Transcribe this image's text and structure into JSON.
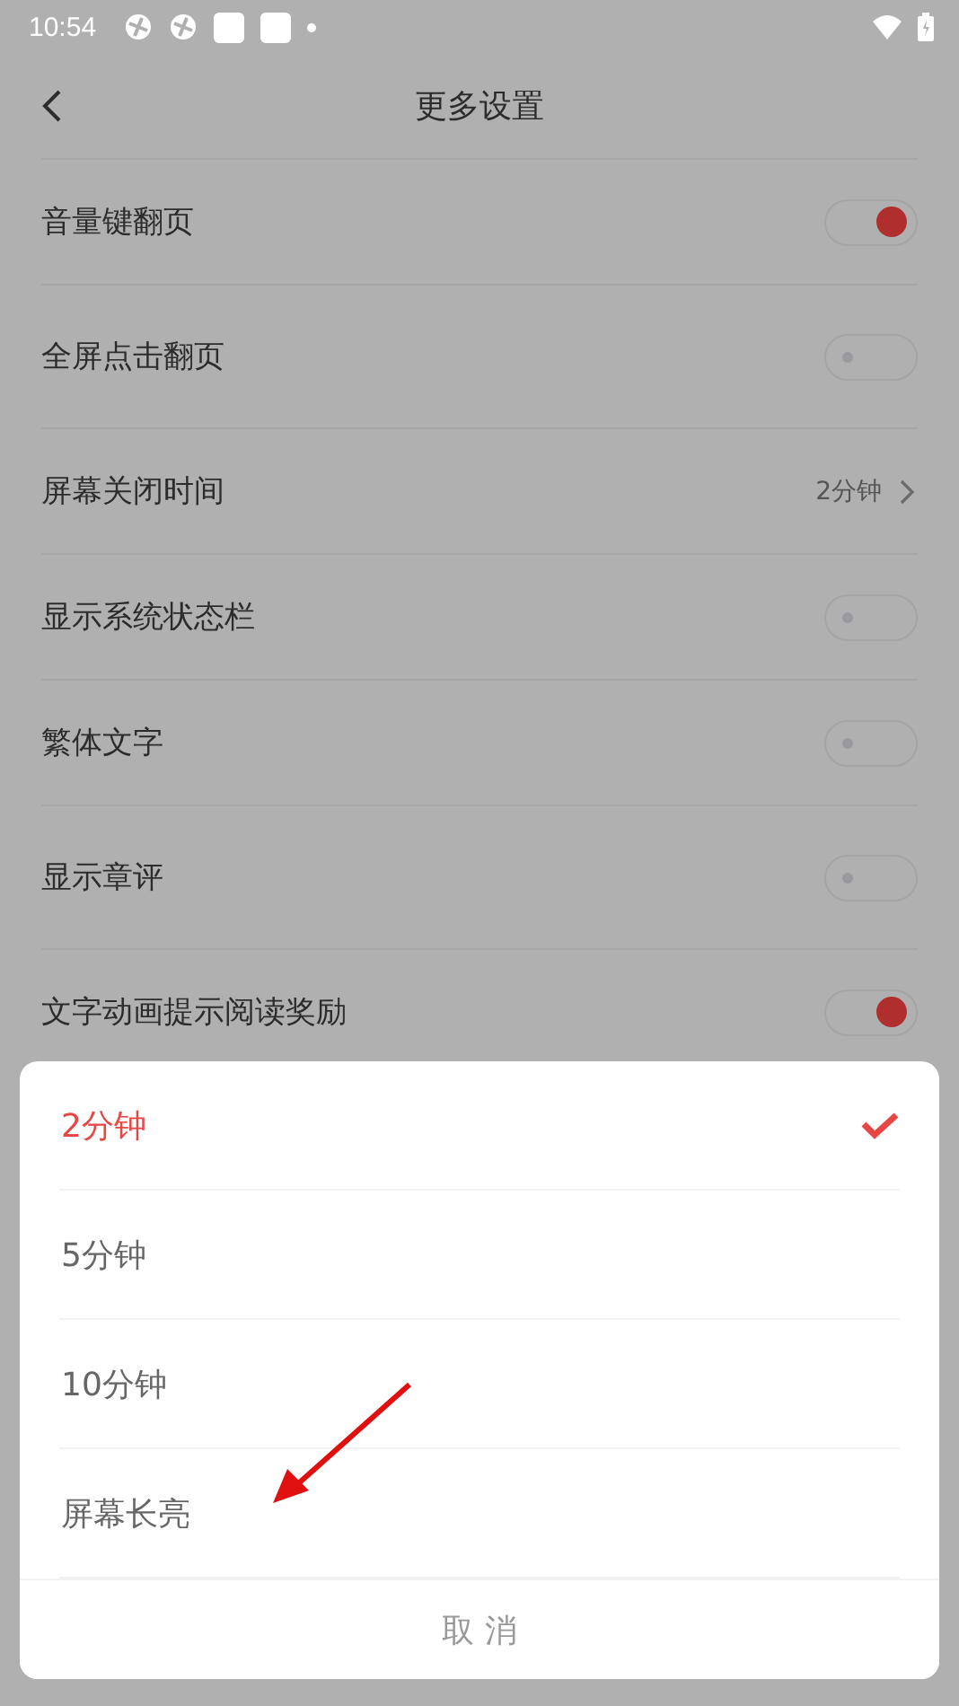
{
  "status_bar": {
    "time": "10:54"
  },
  "header": {
    "title": "更多设置"
  },
  "settings": [
    {
      "kind": "toggle",
      "label": "音量键翻页",
      "on": true
    },
    {
      "kind": "toggle",
      "label": "全屏点击翻页",
      "on": false
    },
    {
      "kind": "value",
      "label": "屏幕关闭时间",
      "value": "2分钟"
    },
    {
      "kind": "toggle",
      "label": "显示系统状态栏",
      "on": false
    },
    {
      "kind": "toggle",
      "label": "繁体文字",
      "on": false
    },
    {
      "kind": "toggle",
      "label": "显示章评",
      "on": false
    },
    {
      "kind": "toggle",
      "label": "文字动画提示阅读奖励",
      "on": true
    }
  ],
  "sheet": {
    "options": [
      {
        "label": "2分钟",
        "selected": true
      },
      {
        "label": "5分钟",
        "selected": false
      },
      {
        "label": "10分钟",
        "selected": false
      },
      {
        "label": "屏幕长亮",
        "selected": false
      }
    ],
    "cancel": "取 消"
  }
}
